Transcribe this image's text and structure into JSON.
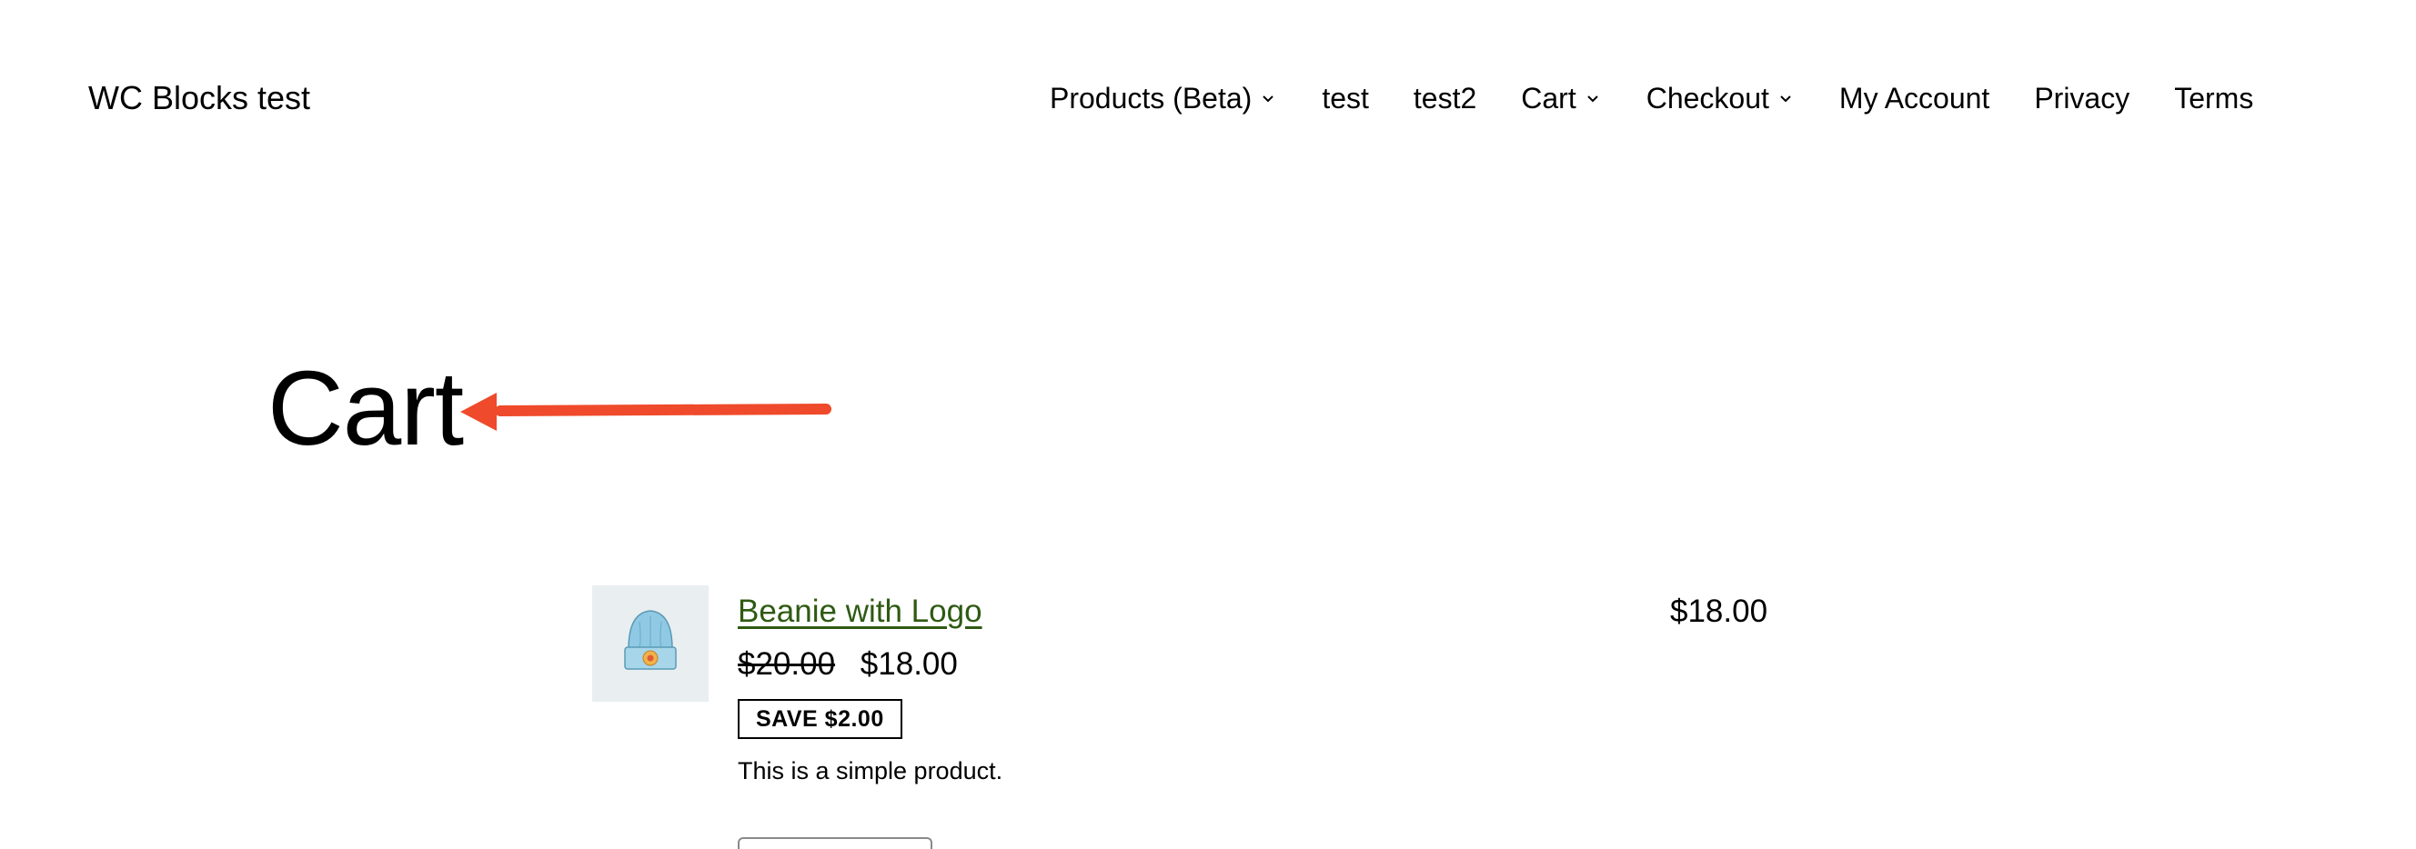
{
  "header": {
    "site_title": "WC Blocks test",
    "nav": {
      "products_beta": "Products (Beta)",
      "test": "test",
      "test2": "test2",
      "cart": "Cart",
      "checkout": "Checkout",
      "my_account": "My Account",
      "privacy": "Privacy",
      "terms": "Terms"
    }
  },
  "main": {
    "page_title": "Cart",
    "annotation_color": "#ef4a2b",
    "cart_item": {
      "product_name": "Beanie with Logo",
      "regular_price": "$20.00",
      "sale_price": "$18.00",
      "save_badge": "SAVE $2.00",
      "description": "This is a simple product.",
      "line_total": "$18.00",
      "image_icon": "beanie-icon"
    }
  },
  "colors": {
    "link": "#2e5a12",
    "thumbnail_bg": "#e9eef0",
    "beanie": "#8fc9e3"
  }
}
